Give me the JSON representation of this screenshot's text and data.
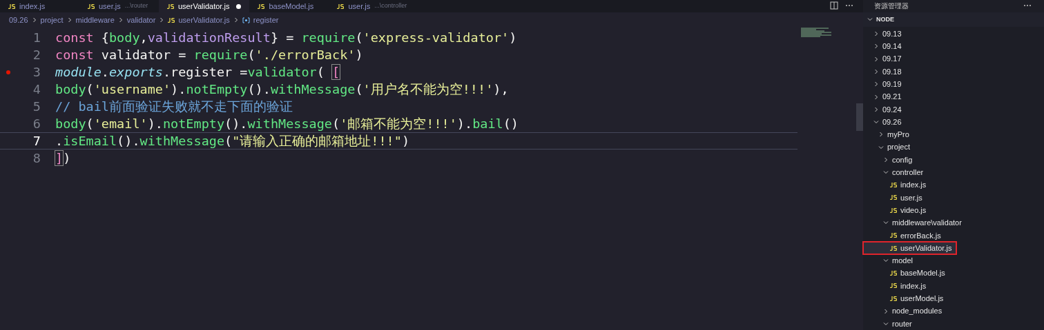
{
  "tabs": [
    {
      "label": "index.js",
      "selected": false,
      "modified": false
    },
    {
      "label": "user.js",
      "description": "...\\router",
      "selected": false,
      "modified": false
    },
    {
      "label": "userValidator.js",
      "selected": true,
      "modified": true
    },
    {
      "label": "baseModel.js",
      "selected": false,
      "modified": false
    },
    {
      "label": "user.js",
      "description": "...\\controller",
      "selected": false,
      "modified": false
    }
  ],
  "breadcrumb": [
    {
      "text": "09.26",
      "kind": "folder"
    },
    {
      "text": "project",
      "kind": "folder"
    },
    {
      "text": "middleware",
      "kind": "folder"
    },
    {
      "text": "validator",
      "kind": "folder"
    },
    {
      "text": "userValidator.js",
      "kind": "js"
    },
    {
      "text": "register",
      "kind": "symbol"
    }
  ],
  "code": [
    {
      "number": "1",
      "active": false,
      "breakpoint": false,
      "tokens": [
        {
          "t": "const",
          "kind": "keyword"
        },
        {
          "t": " {",
          "kind": "plain"
        },
        {
          "t": "body",
          "kind": "func"
        },
        {
          "t": ",",
          "kind": "plain"
        },
        {
          "t": "validationResult",
          "kind": "var"
        },
        {
          "t": "} = ",
          "kind": "plain"
        },
        {
          "t": "require",
          "kind": "func"
        },
        {
          "t": "(",
          "kind": "plain"
        },
        {
          "t": "'express-validator'",
          "kind": "string"
        },
        {
          "t": ")",
          "kind": "plain"
        }
      ]
    },
    {
      "number": "2",
      "active": false,
      "breakpoint": false,
      "tokens": [
        {
          "t": "const",
          "kind": "keyword"
        },
        {
          "t": " validator = ",
          "kind": "plain"
        },
        {
          "t": "require",
          "kind": "func"
        },
        {
          "t": "(",
          "kind": "plain"
        },
        {
          "t": "'./errorBack'",
          "kind": "string"
        },
        {
          "t": ")",
          "kind": "plain"
        }
      ]
    },
    {
      "number": "3",
      "active": false,
      "breakpoint": true,
      "tokens": [
        {
          "t": "module",
          "kind": "italic"
        },
        {
          "t": ".",
          "kind": "plain"
        },
        {
          "t": "exports",
          "kind": "italic"
        },
        {
          "t": ".register =",
          "kind": "plain"
        },
        {
          "t": "validator",
          "kind": "func"
        },
        {
          "t": "( ",
          "kind": "plain"
        },
        {
          "t": "[",
          "kind": "bracket"
        }
      ]
    },
    {
      "number": "4",
      "active": false,
      "breakpoint": false,
      "tokens": [
        {
          "t": "body",
          "kind": "func"
        },
        {
          "t": "(",
          "kind": "plain"
        },
        {
          "t": "'username'",
          "kind": "string"
        },
        {
          "t": ").",
          "kind": "plain"
        },
        {
          "t": "notEmpty",
          "kind": "func"
        },
        {
          "t": "().",
          "kind": "plain"
        },
        {
          "t": "withMessage",
          "kind": "func"
        },
        {
          "t": "(",
          "kind": "plain"
        },
        {
          "t": "'用户名不能为空!!!'",
          "kind": "string"
        },
        {
          "t": "),",
          "kind": "plain"
        }
      ]
    },
    {
      "number": "5",
      "active": false,
      "breakpoint": false,
      "tokens": [
        {
          "t": "// bail前面验证失败就不走下面的验证",
          "kind": "comment"
        }
      ]
    },
    {
      "number": "6",
      "active": false,
      "breakpoint": false,
      "tokens": [
        {
          "t": "body",
          "kind": "func"
        },
        {
          "t": "(",
          "kind": "plain"
        },
        {
          "t": "'email'",
          "kind": "string"
        },
        {
          "t": ").",
          "kind": "plain"
        },
        {
          "t": "notEmpty",
          "kind": "func"
        },
        {
          "t": "().",
          "kind": "plain"
        },
        {
          "t": "withMessage",
          "kind": "func"
        },
        {
          "t": "(",
          "kind": "plain"
        },
        {
          "t": "'邮箱不能为空!!!'",
          "kind": "string"
        },
        {
          "t": ").",
          "kind": "plain"
        },
        {
          "t": "bail",
          "kind": "func"
        },
        {
          "t": "()",
          "kind": "plain"
        }
      ]
    },
    {
      "number": "7",
      "active": true,
      "breakpoint": false,
      "tokens": [
        {
          "t": ".",
          "kind": "plain"
        },
        {
          "t": "isEmail",
          "kind": "func"
        },
        {
          "t": "().",
          "kind": "plain"
        },
        {
          "t": "withMessage",
          "kind": "func"
        },
        {
          "t": "(",
          "kind": "plain"
        },
        {
          "t": "\"请输入正确的邮箱地址!!!\"",
          "kind": "string"
        },
        {
          "t": ")",
          "kind": "plain"
        }
      ]
    },
    {
      "number": "8",
      "active": false,
      "breakpoint": false,
      "tokens": [
        {
          "t": "]",
          "kind": "bracket"
        },
        {
          "t": ")",
          "kind": "plain"
        }
      ]
    }
  ],
  "explorer": {
    "title": "资源管理器",
    "section": {
      "label": "NODE",
      "expanded": true
    },
    "tree": [
      {
        "label": "09.13",
        "kind": "folder",
        "expanded": false,
        "selected": false
      },
      {
        "label": "09.14",
        "kind": "folder",
        "expanded": false,
        "selected": false
      },
      {
        "label": "09.17",
        "kind": "folder",
        "expanded": false,
        "selected": false
      },
      {
        "label": "09.18",
        "kind": "folder",
        "expanded": false,
        "selected": false
      },
      {
        "label": "09.19",
        "kind": "folder",
        "expanded": false,
        "selected": false
      },
      {
        "label": "09.21",
        "kind": "folder",
        "expanded": false,
        "selected": false
      },
      {
        "label": "09.24",
        "kind": "folder",
        "expanded": false,
        "selected": false
      },
      {
        "label": "09.26",
        "kind": "folder",
        "expanded": true,
        "selected": false,
        "children": [
          {
            "label": "myPro",
            "kind": "folder",
            "expanded": false,
            "selected": false
          },
          {
            "label": "project",
            "kind": "folder",
            "expanded": true,
            "selected": false,
            "children": [
              {
                "label": "config",
                "kind": "folder",
                "expanded": false,
                "selected": false
              },
              {
                "label": "controller",
                "kind": "folder",
                "expanded": true,
                "selected": false,
                "children": [
                  {
                    "label": "index.js",
                    "kind": "js",
                    "selected": false
                  },
                  {
                    "label": "user.js",
                    "kind": "js",
                    "selected": false
                  },
                  {
                    "label": "video.js",
                    "kind": "js",
                    "selected": false
                  }
                ]
              },
              {
                "label": "middleware\\validator",
                "kind": "folder",
                "expanded": true,
                "selected": false,
                "children": [
                  {
                    "label": "errorBack.js",
                    "kind": "js",
                    "selected": false
                  },
                  {
                    "label": "userValidator.js",
                    "kind": "js",
                    "selected": true
                  }
                ]
              },
              {
                "label": "model",
                "kind": "folder",
                "expanded": true,
                "selected": false,
                "children": [
                  {
                    "label": "baseModel.js",
                    "kind": "js",
                    "selected": false
                  },
                  {
                    "label": "index.js",
                    "kind": "js",
                    "selected": false
                  },
                  {
                    "label": "userModel.js",
                    "kind": "js",
                    "selected": false
                  }
                ]
              },
              {
                "label": "node_modules",
                "kind": "folder",
                "expanded": false,
                "selected": false
              },
              {
                "label": "router",
                "kind": "folder",
                "expanded": true,
                "selected": false
              }
            ]
          }
        ]
      }
    ]
  }
}
